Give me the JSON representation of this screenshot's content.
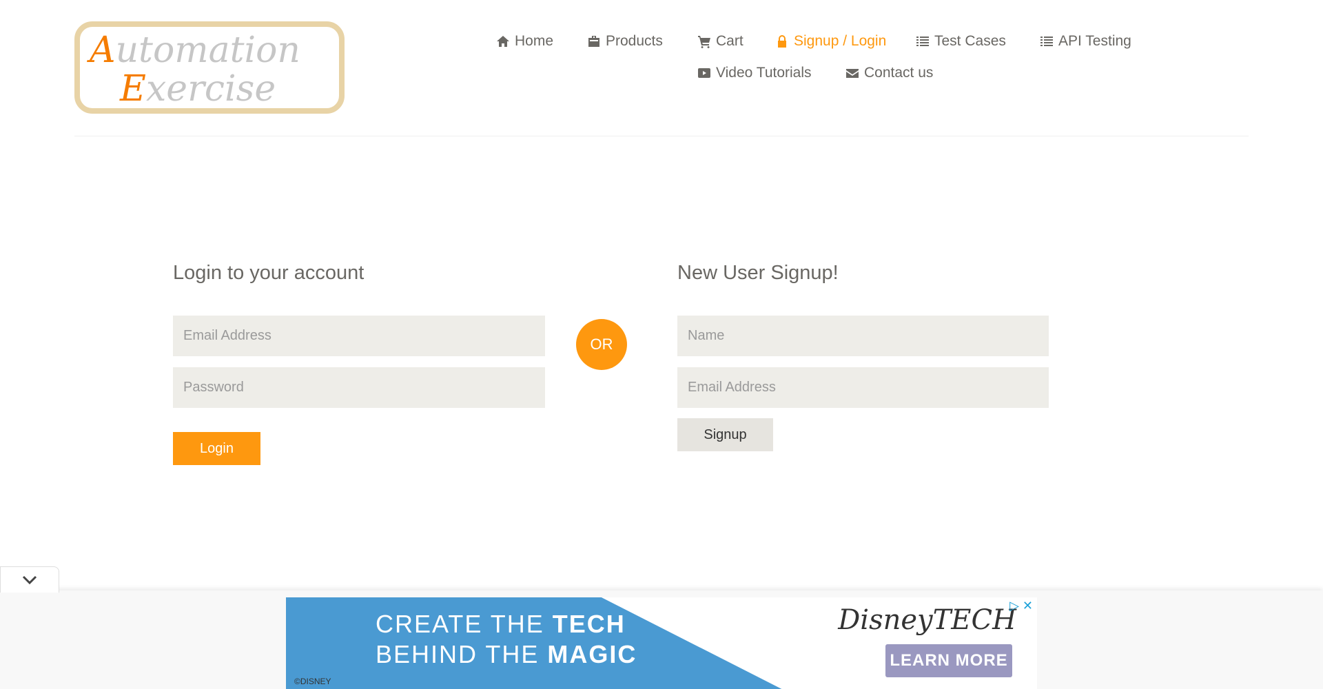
{
  "logo": {
    "line1_first": "A",
    "line1_rest": "utomation",
    "line2_first": "E",
    "line2_rest": "xercise"
  },
  "nav": [
    {
      "label": "Home",
      "icon": "home-icon"
    },
    {
      "label": "Products",
      "icon": "briefcase-icon"
    },
    {
      "label": "Cart",
      "icon": "cart-icon"
    },
    {
      "label": "Signup / Login",
      "icon": "lock-icon",
      "active": true
    },
    {
      "label": "Test Cases",
      "icon": "list-icon"
    },
    {
      "label": "API Testing",
      "icon": "list-icon"
    },
    {
      "label": "Video Tutorials",
      "icon": "youtube-play-icon"
    },
    {
      "label": "Contact us",
      "icon": "envelope-icon"
    }
  ],
  "login": {
    "title": "Login to your account",
    "email_placeholder": "Email Address",
    "password_placeholder": "Password",
    "button": "Login"
  },
  "or": "OR",
  "signup": {
    "title": "New User Signup!",
    "name_placeholder": "Name",
    "email_placeholder": "Email Address",
    "button": "Signup"
  },
  "ad": {
    "line1a": "CREATE THE ",
    "line1b": "TECH",
    "line2a": "BEHIND THE ",
    "line2b": "MAGIC",
    "brand": "DisneyTECH",
    "cta": "LEARN MORE",
    "copyright": "©DISNEY",
    "close": "✕"
  },
  "colors": {
    "accent": "#fe980f",
    "text": "#696763",
    "input_bg": "#eeede8"
  }
}
